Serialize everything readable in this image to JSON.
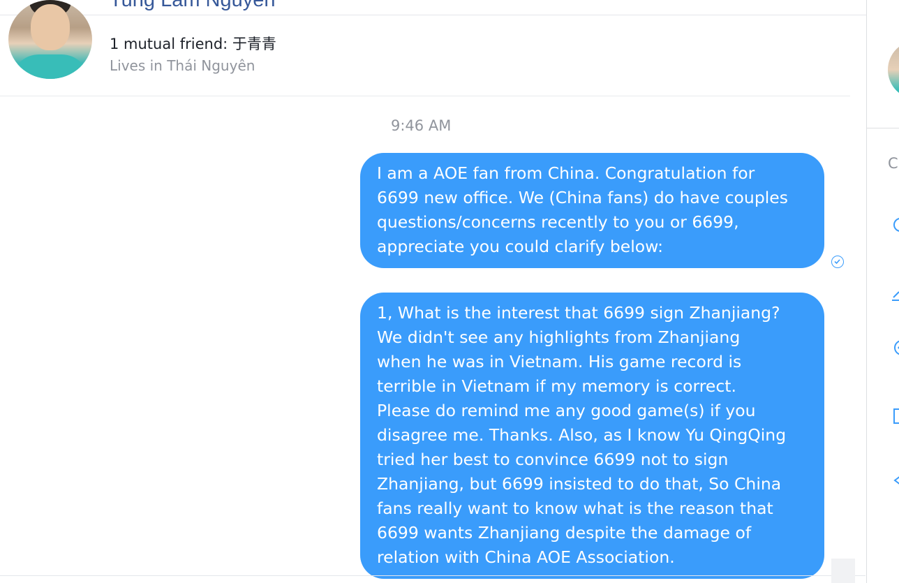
{
  "profile": {
    "name": "Tung Lam Nguyen",
    "mutual_friend": "1 mutual friend: 于青青",
    "lives_in": "Lives in Thái Nguyên"
  },
  "conversation": {
    "timestamp": "9:46 AM",
    "messages": [
      {
        "lines": [
          "I am a AOE fan from China. Congratulation for",
          "6699 new office. We (China fans) do have couples",
          "questions/concerns recently to you or 6699,",
          "appreciate you could clarify below:"
        ]
      },
      {
        "lines": [
          "1, What is the interest that 6699 sign Zhanjiang?",
          "We didn't see any highlights from Zhanjiang",
          "when he was in Vietnam. His game record is",
          "terrible in Vietnam if my memory is correct.",
          "Please do remind me any good game(s) if you",
          "disagree me. Thanks. Also, as I know Yu QingQing",
          "tried her best to convince 6699 not to sign",
          "Zhanjiang, but 6699 insisted to do that, So China",
          "fans really want to know what is the reason that",
          "6699 wants Zhanjiang despite the damage of",
          "relation with China AOE Association."
        ]
      }
    ]
  },
  "right_panel": {
    "section_letter": "C"
  },
  "colors": {
    "bubble": "#3a9cfb",
    "name_link": "#365899",
    "secondary_text": "#90949c"
  }
}
